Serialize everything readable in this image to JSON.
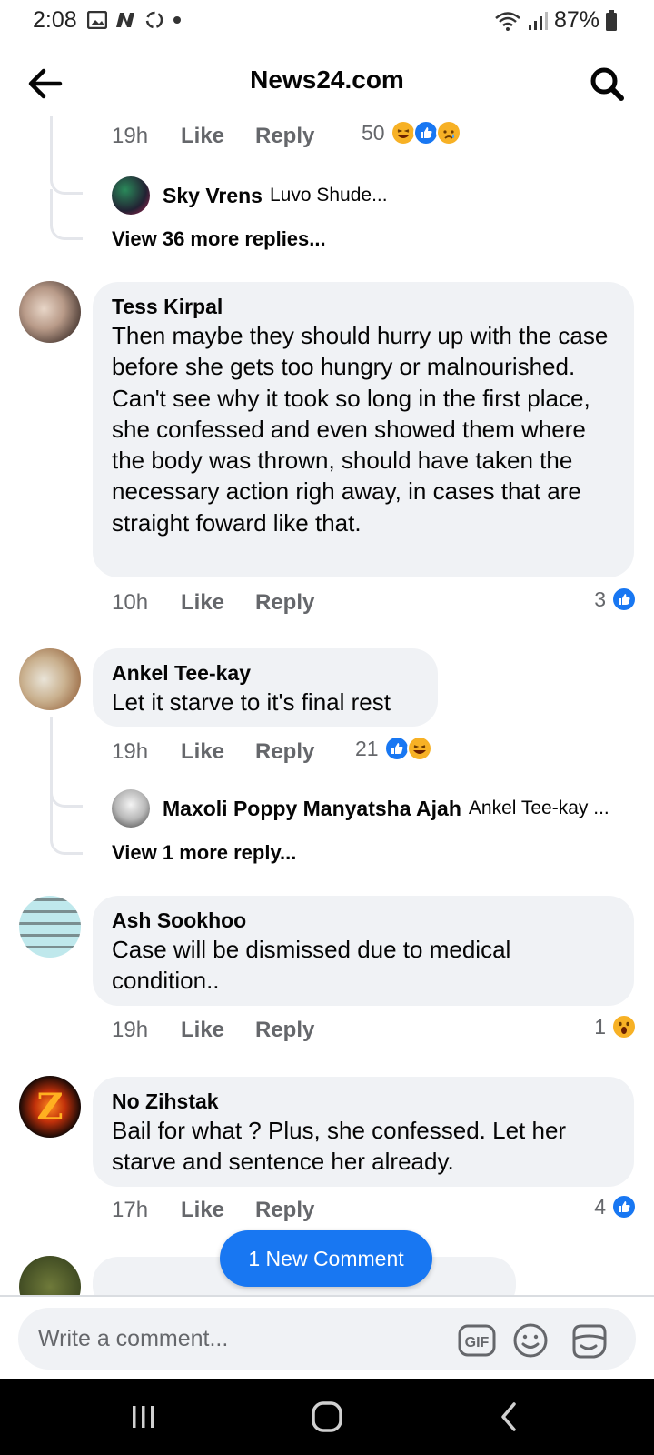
{
  "status_bar": {
    "time": "2:08",
    "battery": "87%"
  },
  "header": {
    "title": "News24.com"
  },
  "top_thread": {
    "meta": {
      "time": "19h",
      "like": "Like",
      "reply": "Reply"
    },
    "reaction_count": "50",
    "reply_preview": {
      "name": "Sky Vrens",
      "snippet": "Luvo Shude..."
    },
    "view_more": "View 36 more replies..."
  },
  "comments": [
    {
      "author": "Tess Kirpal",
      "text": "Then maybe they should hurry up with the case before she gets too hungry or malnourished. Can't see why it took so long in the first place, she confessed and even showed them where the body was thrown, should have taken the necessary action righ away, in cases that are straight foward like that.",
      "time": "10h",
      "like": "Like",
      "reply": "Reply",
      "reaction_count": "3"
    },
    {
      "author": "Ankel Tee-kay",
      "text": "Let it starve to it's final rest",
      "time": "19h",
      "like": "Like",
      "reply": "Reply",
      "reaction_count": "21",
      "reply_preview": {
        "name": "Maxoli Poppy Manyatsha Ajah",
        "snippet": "Ankel Tee-kay ..."
      },
      "view_more": "View 1 more reply..."
    },
    {
      "author": "Ash Sookhoo",
      "text": "Case will be dismissed due to medical condition..",
      "time": "19h",
      "like": "Like",
      "reply": "Reply",
      "reaction_count": "1"
    },
    {
      "author": "No Zihstak",
      "text": "Bail for what ? Plus, she confessed. Let her starve and sentence her already.",
      "time": "17h",
      "like": "Like",
      "reply": "Reply",
      "reaction_count": "4"
    }
  ],
  "new_comment_pill": "1 New Comment",
  "composer": {
    "placeholder": "Write a comment...",
    "gif_label": "GIF"
  },
  "colors": {
    "accent": "#1877f2",
    "bubble": "#f0f2f5",
    "secondary_text": "#65676b",
    "haha": "#f7b125"
  }
}
